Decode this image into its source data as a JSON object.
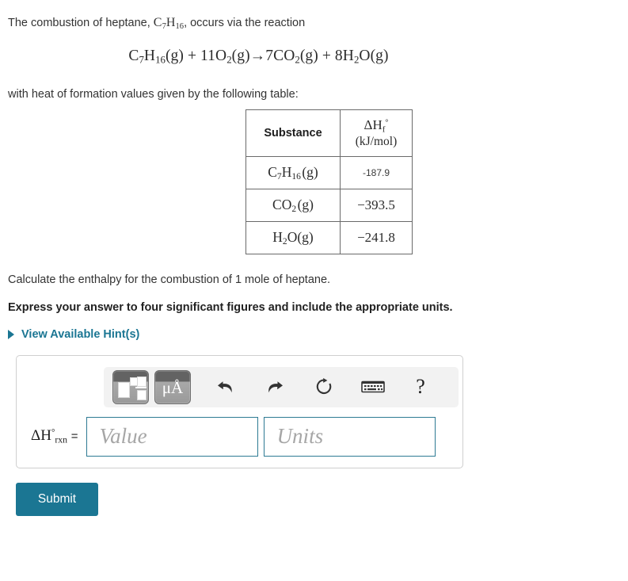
{
  "problem": {
    "intro_before": "The combustion of heptane, ",
    "intro_formula": "C7H16",
    "intro_after": ", occurs via the reaction",
    "equation": "C7H16(g) + 11O2(g)→7CO2(g) + 8H2O(g)",
    "table_lead_in": "with heat of formation values given by the following table:",
    "calculate_text": "Calculate the enthalpy for the combustion of 1 mole of heptane.",
    "instruction_bold": "Express your answer to four significant figures and include the appropriate units."
  },
  "table": {
    "headers": {
      "substance": "Substance",
      "delta_symbol": "ΔH",
      "delta_sub": "f",
      "delta_sup": "°",
      "units": "(kJ/mol)"
    },
    "rows": [
      {
        "substance": "C7H16(g)",
        "value": "-187.9",
        "style": "sans"
      },
      {
        "substance": "CO2(g)",
        "value": "−393.5",
        "style": "serif"
      },
      {
        "substance": "H2O(g)",
        "value": "−241.8",
        "style": "serif"
      }
    ]
  },
  "hints": {
    "label": "View Available Hint(s)",
    "icon": "triangle-right-icon",
    "color": "#1b7693"
  },
  "answer_panel": {
    "toolbar": {
      "buttons": [
        {
          "name": "math-template-button",
          "label": ""
        },
        {
          "name": "units-button",
          "label": "μA"
        },
        {
          "name": "undo-button",
          "icon": "undo-arrow-icon"
        },
        {
          "name": "redo-button",
          "icon": "redo-arrow-icon"
        },
        {
          "name": "reset-button",
          "icon": "refresh-circle-icon"
        },
        {
          "name": "keyboard-button",
          "icon": "keyboard-icon"
        },
        {
          "name": "help-button",
          "icon": "question-mark-icon",
          "label": "?"
        }
      ],
      "mu": "μ",
      "angstrom": "A",
      "help_label": "?"
    },
    "label": {
      "delta_h": "ΔH",
      "superscript": "°",
      "subscript": "rxn",
      "equals": "="
    },
    "value_placeholder": "Value",
    "units_placeholder": "Units"
  },
  "submit": {
    "label": "Submit",
    "color": "#1b7693"
  }
}
